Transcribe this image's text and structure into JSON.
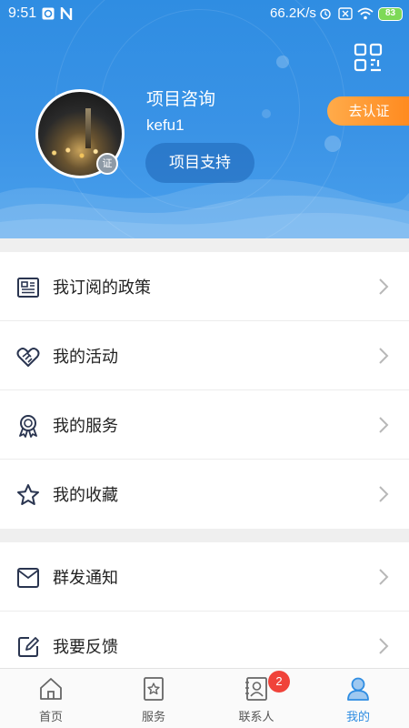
{
  "status_bar": {
    "time": "9:51",
    "speed": "66.2K/s",
    "battery": "83",
    "icons": [
      "notification-icon",
      "n-app-icon",
      "alarm-icon",
      "sim-icon",
      "wifi-icon"
    ]
  },
  "profile": {
    "title": "项目咨询",
    "username": "kefu1",
    "support_button": "项目支持",
    "certify_button": "去认证",
    "avatar_badge": "证"
  },
  "menu_groups": [
    [
      {
        "label": "我订阅的政策",
        "icon": "policy-document-icon"
      },
      {
        "label": "我的活动",
        "icon": "handshake-heart-icon"
      },
      {
        "label": "我的服务",
        "icon": "award-ribbon-icon"
      },
      {
        "label": "我的收藏",
        "icon": "star-icon"
      }
    ],
    [
      {
        "label": "群发通知",
        "icon": "envelope-icon"
      },
      {
        "label": "我要反馈",
        "icon": "edit-icon"
      }
    ]
  ],
  "tabs": [
    {
      "label": "首页",
      "icon": "home-icon"
    },
    {
      "label": "服务",
      "icon": "service-icon"
    },
    {
      "label": "联系人",
      "icon": "contacts-icon"
    },
    {
      "label": "我的",
      "icon": "user-icon",
      "active": true
    }
  ],
  "contacts_badge": "2",
  "colors": {
    "header_blue": "#2f8de2",
    "accent_orange": "#ff8a1f",
    "badge_red": "#f0433a",
    "active_tab": "#2f8de2"
  }
}
